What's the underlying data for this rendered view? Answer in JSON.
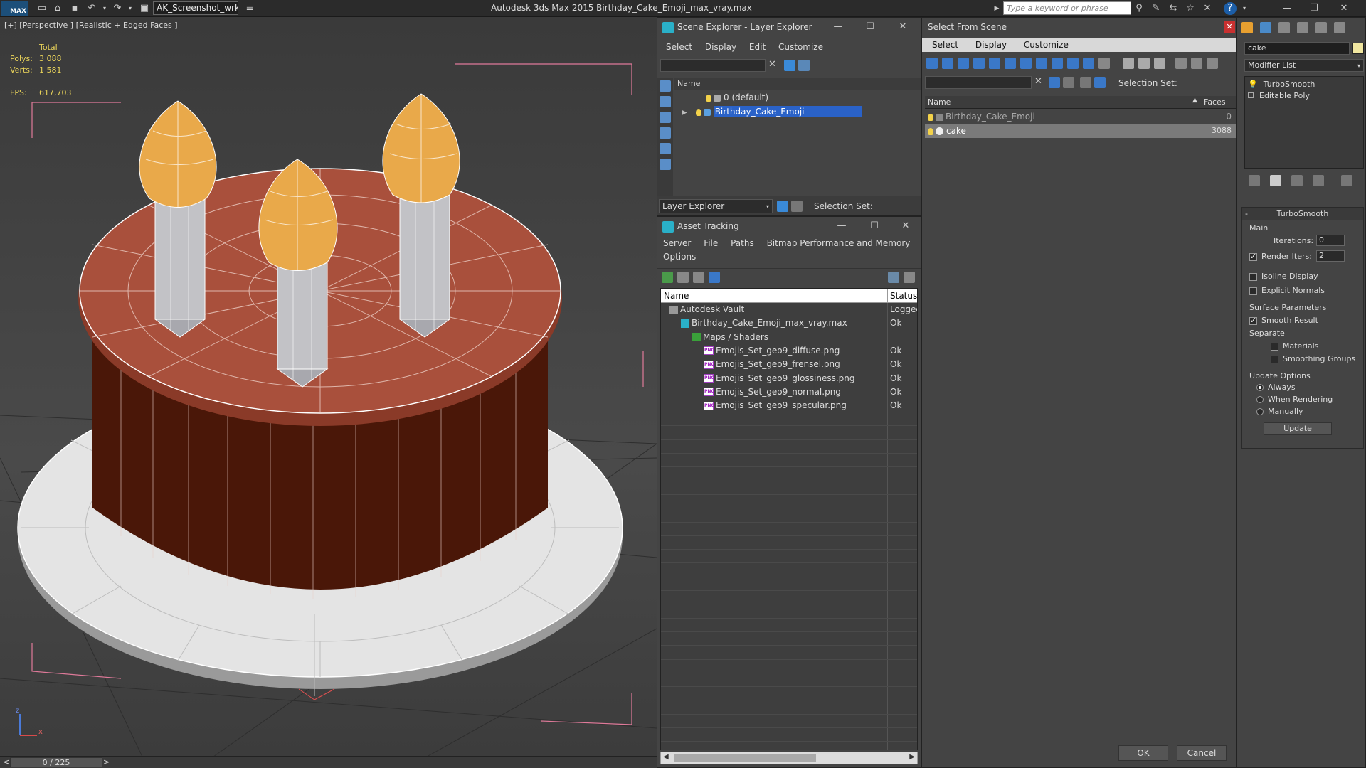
{
  "titlebar": {
    "workspace": "AK_Screenshot_wrksp",
    "app_title": "Autodesk 3ds Max  2015     Birthday_Cake_Emoji_max_vray.max",
    "search_placeholder": "Type a keyword or phrase",
    "logo": "MAX"
  },
  "viewport": {
    "label": "[+] [Perspective ] [Realistic + Edged Faces ]",
    "stats": {
      "total_label": "Total",
      "polys_label": "Polys:",
      "polys_value": "3 088",
      "verts_label": "Verts:",
      "verts_value": "1 581",
      "fps_label": "FPS:",
      "fps_value": "617,703"
    },
    "colors": {
      "cake_top": "#a9503c",
      "cake_side": "#4a1708",
      "plate": "#e4e4e4",
      "flame": "#e9a94a",
      "candle": "#c2c2c6",
      "wire": "#ffffff",
      "bbox": "#e07a9a"
    }
  },
  "timeline": {
    "frame": "0 / 225",
    "prev": "<",
    "next": ">"
  },
  "scene_explorer": {
    "title": "Scene Explorer - Layer Explorer",
    "menu": [
      "Select",
      "Display",
      "Edit",
      "Customize"
    ],
    "column_name": "Name",
    "layers": [
      {
        "name": "0 (default)",
        "selected": false
      },
      {
        "name": "Birthday_Cake_Emoji",
        "selected": true
      }
    ],
    "footer_dropdown": "Layer Explorer",
    "selection_set_label": "Selection Set:"
  },
  "asset_tracking": {
    "title": "Asset Tracking",
    "menu": [
      "Server",
      "File",
      "Paths",
      "Bitmap Performance and Memory"
    ],
    "menu_row2": "Options",
    "col_name": "Name",
    "col_status": "Status",
    "rows": [
      {
        "name": "Autodesk Vault",
        "status": "Logged",
        "indent": 0,
        "icon": "vault-icon"
      },
      {
        "name": "Birthday_Cake_Emoji_max_vray.max",
        "status": "Ok",
        "indent": 1,
        "icon": "max-file-icon"
      },
      {
        "name": "Maps / Shaders",
        "status": "",
        "indent": 2,
        "icon": "maps-icon"
      },
      {
        "name": "Emojis_Set_geo9_diffuse.png",
        "status": "Ok",
        "indent": 3,
        "icon": "png-icon"
      },
      {
        "name": "Emojis_Set_geo9_frensel.png",
        "status": "Ok",
        "indent": 3,
        "icon": "png-icon"
      },
      {
        "name": "Emojis_Set_geo9_glossiness.png",
        "status": "Ok",
        "indent": 3,
        "icon": "png-icon"
      },
      {
        "name": "Emojis_Set_geo9_normal.png",
        "status": "Ok",
        "indent": 3,
        "icon": "png-icon"
      },
      {
        "name": "Emojis_Set_geo9_specular.png",
        "status": "Ok",
        "indent": 3,
        "icon": "png-icon"
      }
    ]
  },
  "select_from_scene": {
    "title": "Select From Scene",
    "menu": [
      "Select",
      "Display",
      "Customize"
    ],
    "selection_set_label": "Selection Set:",
    "col_name": "Name",
    "col_faces": "Faces",
    "rows": [
      {
        "name": "Birthday_Cake_Emoji",
        "faces": "0",
        "selected": false
      },
      {
        "name": "cake",
        "faces": "3088",
        "selected": true
      }
    ],
    "ok_label": "OK",
    "cancel_label": "Cancel"
  },
  "modifier_panel": {
    "object_name": "cake",
    "modifier_list_label": "Modifier List",
    "stack": [
      "TurboSmooth",
      "Editable Poly"
    ],
    "rollout_title": "TurboSmooth",
    "main_label": "Main",
    "iterations_label": "Iterations:",
    "iterations_value": "0",
    "render_iters_label": "Render Iters:",
    "render_iters_value": "2",
    "isoline_label": "Isoline Display",
    "explicit_normals_label": "Explicit Normals",
    "surface_params_label": "Surface Parameters",
    "smooth_result_label": "Smooth Result",
    "separate_label": "Separate",
    "materials_label": "Materials",
    "smoothing_groups_label": "Smoothing Groups",
    "update_options_label": "Update Options",
    "always_label": "Always",
    "when_rendering_label": "When Rendering",
    "manually_label": "Manually",
    "update_button": "Update"
  }
}
